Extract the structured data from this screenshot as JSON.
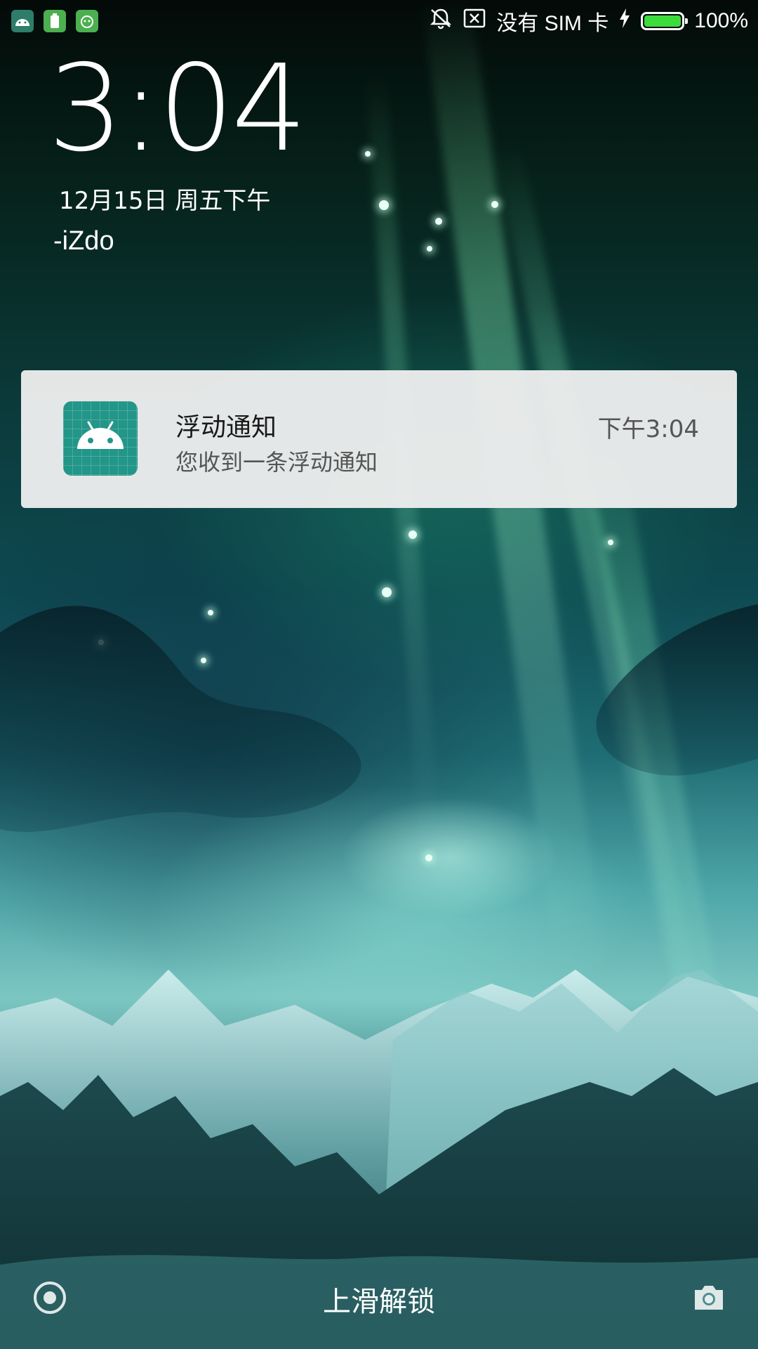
{
  "status_bar": {
    "left_icons": [
      "android-app-icon",
      "battery-app-icon",
      "robot-app-icon"
    ],
    "right_icons": [
      "vibrate-off-icon",
      "sim-missing-icon",
      "charging-bolt-icon",
      "battery-icon"
    ],
    "sim_text": "没有 SIM 卡",
    "battery_percent": "100%",
    "battery_level": 1.0,
    "battery_color": "#3ddc3d"
  },
  "lockscreen": {
    "time": "3:04",
    "date": "12月15日 周五下午",
    "owner_info": "-iZdo"
  },
  "notification": {
    "icon": "android-robot-icon",
    "icon_color": "#229688",
    "title": "浮动通知",
    "body": "您收到一条浮动通知",
    "time": "下午3:04"
  },
  "bottom_bar": {
    "unlock_hint": "上滑解锁",
    "left_icon": "assistant-icon",
    "right_icon": "camera-icon"
  }
}
